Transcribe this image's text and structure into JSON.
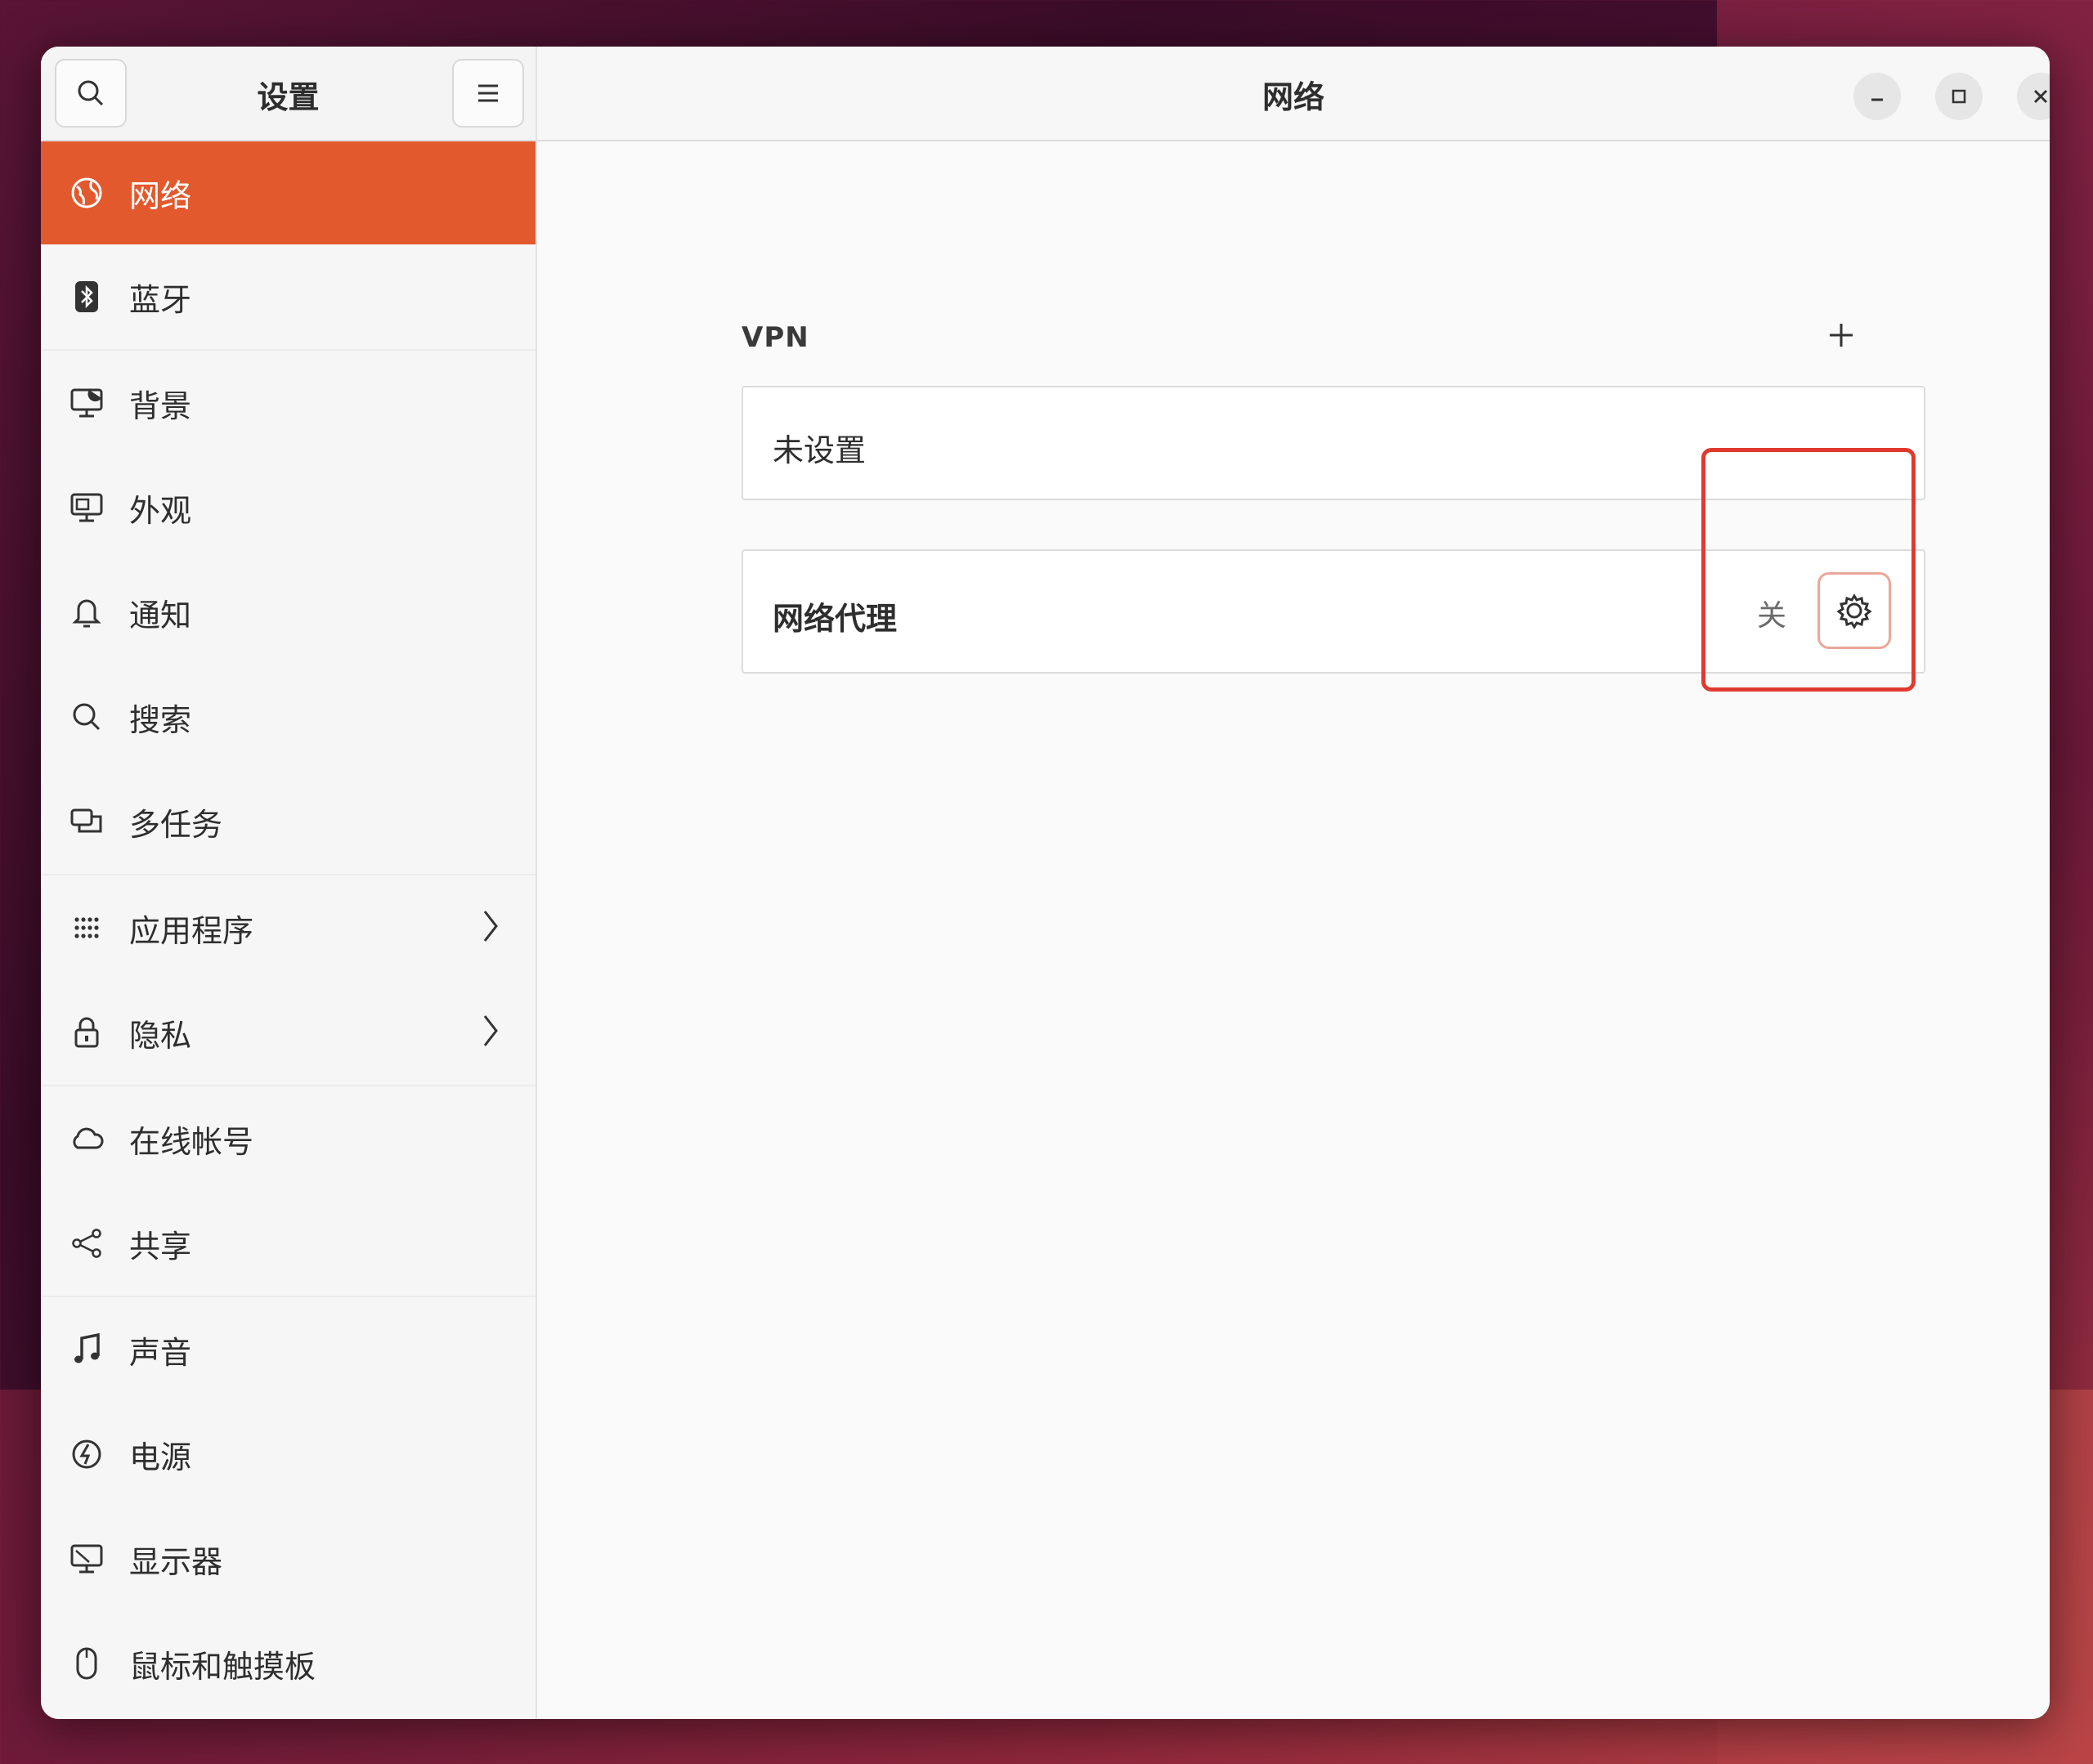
{
  "sidebar": {
    "title": "设置",
    "items": [
      {
        "label": "网络",
        "icon": "globe-icon",
        "active": true
      },
      {
        "label": "蓝牙",
        "icon": "bluetooth-icon"
      },
      {
        "label": "背景",
        "icon": "display-background-icon"
      },
      {
        "label": "外观",
        "icon": "appearance-icon"
      },
      {
        "label": "通知",
        "icon": "bell-icon"
      },
      {
        "label": "搜索",
        "icon": "search-icon"
      },
      {
        "label": "多任务",
        "icon": "multitasking-icon"
      },
      {
        "label": "应用程序",
        "icon": "apps-grid-icon",
        "has_submenu": true
      },
      {
        "label": "隐私",
        "icon": "lock-icon",
        "has_submenu": true
      },
      {
        "label": "在线帐号",
        "icon": "cloud-icon"
      },
      {
        "label": "共享",
        "icon": "share-icon"
      },
      {
        "label": "声音",
        "icon": "music-note-icon"
      },
      {
        "label": "电源",
        "icon": "power-icon"
      },
      {
        "label": "显示器",
        "icon": "monitor-icon"
      },
      {
        "label": "鼠标和触摸板",
        "icon": "mouse-icon"
      }
    ]
  },
  "main": {
    "title": "网络",
    "vpn": {
      "section_label": "VPN",
      "empty_text": "未设置"
    },
    "proxy": {
      "label": "网络代理",
      "status": "关"
    }
  },
  "colors": {
    "accent": "#e3592e",
    "highlight": "#e03a2e"
  }
}
